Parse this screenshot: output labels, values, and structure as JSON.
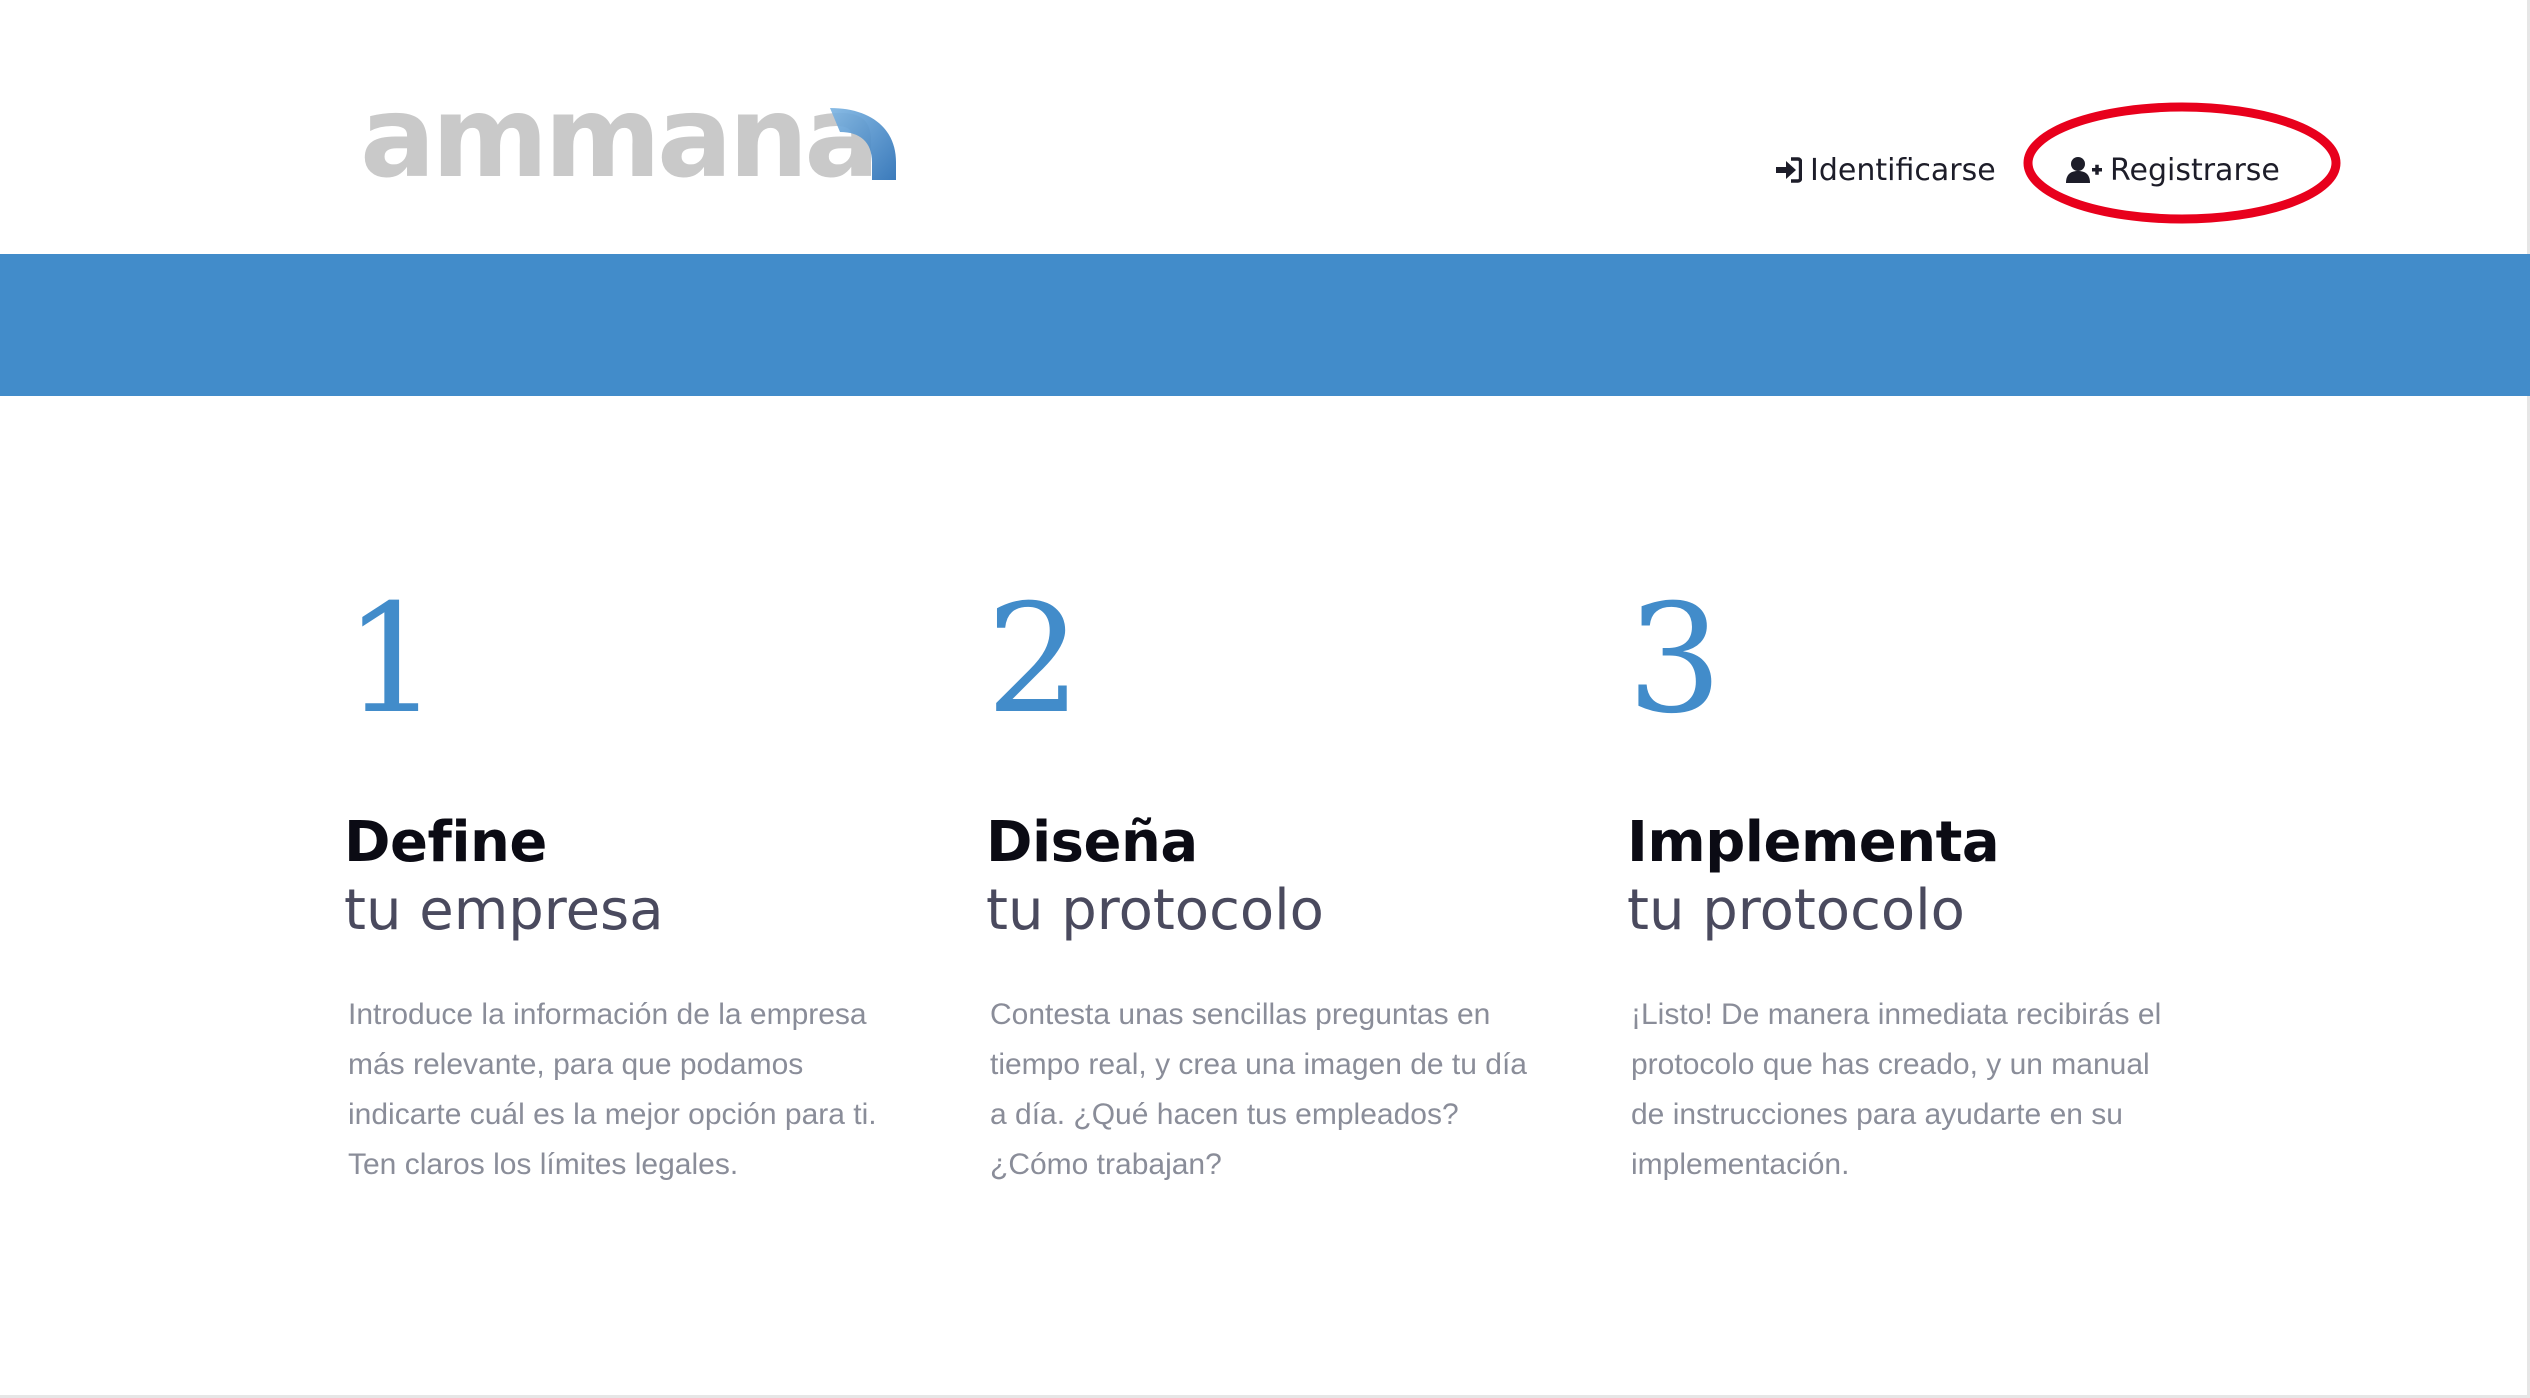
{
  "header": {
    "logo_text": "ammana",
    "login_label": "Identificarse",
    "register_label": "Registrarse",
    "login_icon": "sign-in-icon",
    "register_icon": "user-plus-icon"
  },
  "colors": {
    "brand_blue": "#428cca",
    "highlight_red": "#e8001c",
    "logo_gray": "#c9c9c9"
  },
  "steps": [
    {
      "number": "1",
      "title": "Define",
      "subtitle": "tu empresa",
      "text": "Introduce la información de la empresa más relevante, para que podamos indicarte cuál es la mejor opción para ti. Ten claros los límites legales."
    },
    {
      "number": "2",
      "title": "Diseña",
      "subtitle": "tu protocolo",
      "text": "Contesta unas sencillas preguntas en tiempo real, y crea una imagen de tu día a día. ¿Qué hacen tus empleados? ¿Cómo trabajan?"
    },
    {
      "number": "3",
      "title": "Implementa",
      "subtitle": "tu protocolo",
      "text": "¡Listo! De manera inmediata recibirás el protocolo que has creado, y un manual de instrucciones para ayudarte en su implementación."
    }
  ]
}
